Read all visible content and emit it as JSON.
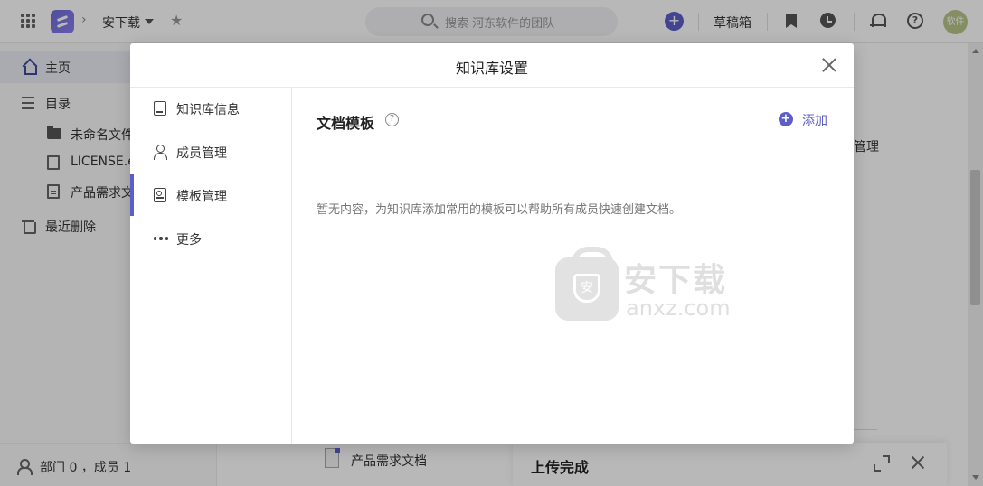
{
  "header": {
    "workspace_title": "安下载",
    "breadcrumb_separator": "›",
    "search_placeholder": "搜索 河东软件的团队",
    "add_symbol": "+",
    "drafts_label": "草稿箱",
    "help_symbol": "?",
    "avatar_text": "软件"
  },
  "sidebar": {
    "items": [
      {
        "label": "主页",
        "icon": "home-icon",
        "active": true
      },
      {
        "label": "目录",
        "icon": "list-icon"
      }
    ],
    "tree": [
      {
        "label": "未命名文件",
        "icon": "folder-icon"
      },
      {
        "label": "LICENSE.elec",
        "icon": "file-icon"
      },
      {
        "label": "产品需求文档",
        "icon": "doc-icon"
      }
    ],
    "trash_label": "最近删除",
    "footer_stats": "部门 0 ，成员 1"
  },
  "background": {
    "template_label_fragment": "管理",
    "file_name": "产品需求文档",
    "upload_title": "上传完成"
  },
  "modal": {
    "title": "知识库设置",
    "nav": [
      {
        "label": "知识库信息",
        "icon": "info-icon"
      },
      {
        "label": "成员管理",
        "icon": "members-icon"
      },
      {
        "label": "模板管理",
        "icon": "template-icon",
        "active": true
      },
      {
        "label": "更多",
        "icon": "more-icon"
      }
    ],
    "content": {
      "heading": "文档模板",
      "help_symbol": "?",
      "add_label": "添加",
      "add_symbol": "+",
      "empty_message": "暂无内容，为知识库添加常用的模板可以帮助所有成员快速创建文档。"
    }
  },
  "watermark": {
    "badge_text": "安",
    "title": "安下载",
    "domain": "anxz.com"
  },
  "colors": {
    "accent": "#5d5fc9",
    "overlay": "rgba(0,0,0,0.28)",
    "avatar": "#b9c58a"
  }
}
